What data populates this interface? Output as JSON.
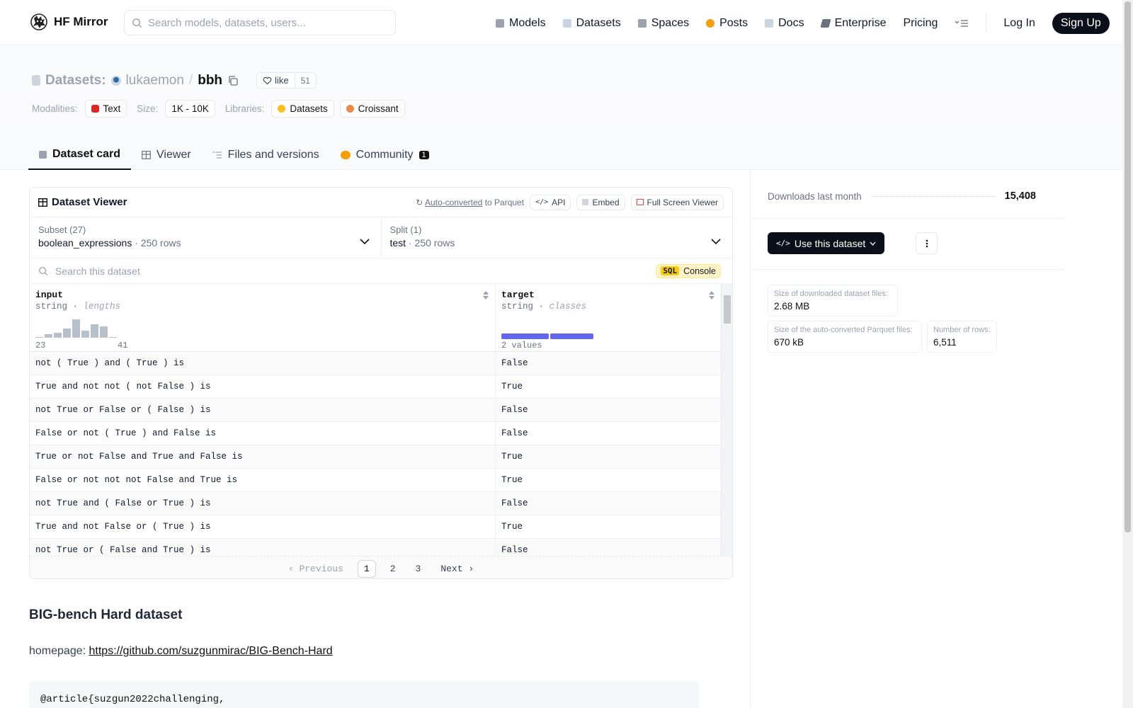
{
  "header": {
    "brand": "HF Mirror",
    "search_placeholder": "Search models, datasets, users...",
    "nav": [
      {
        "label": "Models",
        "icon": "models-icon",
        "color": "#9ca3af"
      },
      {
        "label": "Datasets",
        "icon": "datasets-icon",
        "color": "#cbd5e1"
      },
      {
        "label": "Spaces",
        "icon": "spaces-icon",
        "color": "#9ca3af"
      },
      {
        "label": "Posts",
        "icon": "posts-icon",
        "color": "#f59e0b"
      },
      {
        "label": "Docs",
        "icon": "docs-icon",
        "color": "#cbd5e1"
      },
      {
        "label": "Enterprise",
        "icon": "enterprise-icon",
        "color": "#6b7280"
      },
      {
        "label": "Pricing",
        "icon": "",
        "color": ""
      }
    ],
    "login": "Log In",
    "signup": "Sign Up"
  },
  "repo": {
    "type_label": "Datasets:",
    "owner": "lukaemon",
    "separator": "/",
    "name": "bbh",
    "like_label": "like",
    "like_count": "51",
    "modalities_label": "Modalities:",
    "modality": "Text",
    "size_label": "Size:",
    "size": "1K - 10K",
    "libraries_label": "Libraries:",
    "libraries": [
      "Datasets",
      "Croissant"
    ]
  },
  "tabs": [
    {
      "label": "Dataset card",
      "active": true
    },
    {
      "label": "Viewer",
      "active": false
    },
    {
      "label": "Files and versions",
      "active": false
    },
    {
      "label": "Community",
      "active": false,
      "badge": "1"
    }
  ],
  "viewer": {
    "title": "Dataset Viewer",
    "auto_converted": "Auto-converted",
    "to_parquet": "to Parquet",
    "api": "API",
    "embed": "Embed",
    "fullscreen": "Full Screen Viewer",
    "subset_label": "Subset (27)",
    "subset_value": "boolean_expressions",
    "subset_rows": "250 rows",
    "split_label": "Split (1)",
    "split_value": "test",
    "split_rows": "250 rows",
    "search_placeholder": "Search this dataset",
    "sql": "SQL",
    "console": "Console",
    "columns": [
      {
        "name": "input",
        "type": "string",
        "stat": "lengths",
        "hist_min": "23",
        "hist_max": "41",
        "hist": [
          0.02,
          0.18,
          0.28,
          0.5,
          1.0,
          0.38,
          0.72,
          0.6,
          0.04
        ]
      },
      {
        "name": "target",
        "type": "string",
        "stat": "classes",
        "classes_label": "2 values",
        "class_shares": [
          0.52,
          0.48
        ]
      }
    ],
    "rows": [
      [
        "not ( True ) and ( True ) is",
        "False"
      ],
      [
        "True and not not ( not False ) is",
        "True"
      ],
      [
        "not True or False or ( False ) is",
        "False"
      ],
      [
        "False or not ( True ) and False is",
        "False"
      ],
      [
        "True or not False and True and False is",
        "True"
      ],
      [
        "False or not not not False and True is",
        "True"
      ],
      [
        "not True and ( False or True ) is",
        "False"
      ],
      [
        "True and not False or ( True ) is",
        "True"
      ],
      [
        "not True or ( False and True ) is",
        "False"
      ]
    ],
    "pager": {
      "previous": "Previous",
      "pages": [
        "1",
        "2",
        "3"
      ],
      "current": "1",
      "next": "Next"
    }
  },
  "card": {
    "heading": "BIG-bench Hard dataset",
    "homepage_label": "homepage:",
    "homepage_url": "https://github.com/suzgunmirac/BIG-Bench-Hard",
    "code_first_line": "@article{suzgun2022challenging,"
  },
  "sidebar": {
    "downloads_label": "Downloads last month",
    "downloads_value": "15,408",
    "use_dataset": "Use this dataset",
    "stats": [
      {
        "label": "Size of downloaded dataset files:",
        "value": "2.68 MB"
      },
      {
        "label": "Size of the auto-converted Parquet files:",
        "value": "670 kB"
      },
      {
        "label": "Number of rows:",
        "value": "6,511"
      }
    ]
  }
}
